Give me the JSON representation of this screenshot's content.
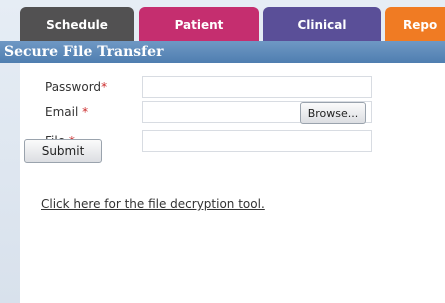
{
  "tabs": [
    {
      "label": "Schedule",
      "color": "#525152"
    },
    {
      "label": "Patient",
      "color": "#c52e6f"
    },
    {
      "label": "Clinical",
      "color": "#5a4f98"
    },
    {
      "label": "Repo",
      "color": "#f07b23"
    }
  ],
  "section": {
    "title": "Secure File Transfer"
  },
  "form": {
    "password_label": "Password",
    "email_label": "Email ",
    "file_label": "File ",
    "required_marker": "*",
    "password_value": "",
    "email_value": "",
    "file_value": "",
    "browse_label": "Browse...",
    "submit_label": "Submit"
  },
  "links": {
    "decrypt_tool": "Click here for the file decryption tool."
  }
}
